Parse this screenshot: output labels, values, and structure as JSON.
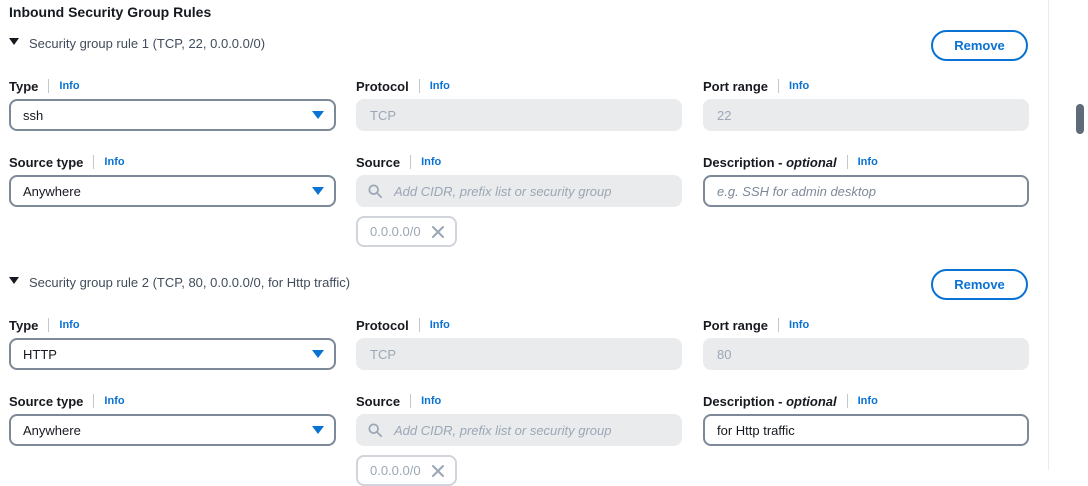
{
  "section": {
    "title": "Inbound Security Group Rules"
  },
  "labels": {
    "type": "Type",
    "protocol": "Protocol",
    "port_range": "Port range",
    "source_type": "Source type",
    "source": "Source",
    "description": "Description",
    "optional": "optional",
    "info": "Info",
    "remove": "Remove"
  },
  "rules": [
    {
      "header": "Security group rule 1 (TCP, 22, 0.0.0.0/0)",
      "type_value": "ssh",
      "protocol_value": "TCP",
      "port_value": "22",
      "source_type_value": "Anywhere",
      "source_placeholder": "Add CIDR, prefix list or security group",
      "source_token": "0.0.0.0/0",
      "description_value": "",
      "description_placeholder": "e.g. SSH for admin desktop"
    },
    {
      "header": "Security group rule 2 (TCP, 80, 0.0.0.0/0, for Http traffic)",
      "type_value": "HTTP",
      "protocol_value": "TCP",
      "port_value": "80",
      "source_type_value": "Anywhere",
      "source_placeholder": "Add CIDR, prefix list or security group",
      "source_token": "0.0.0.0/0",
      "description_value": "for Http traffic",
      "description_placeholder": ""
    }
  ],
  "colors": {
    "accent": "#0972d3",
    "disabled_bg": "#e9ebed",
    "text": "#16191f"
  }
}
